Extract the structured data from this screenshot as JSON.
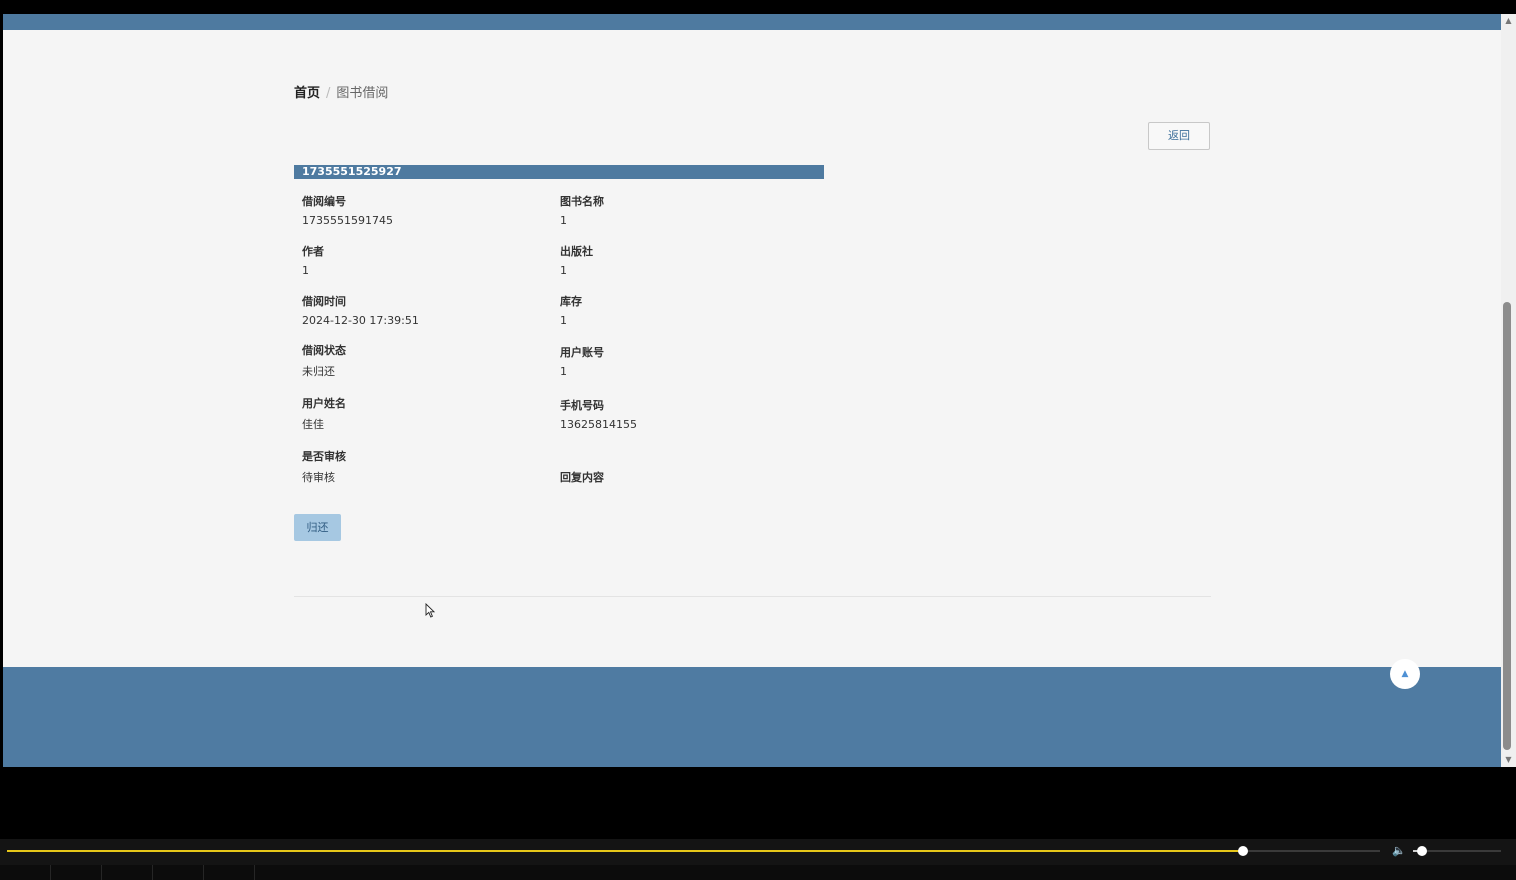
{
  "breadcrumb": {
    "home": "首页",
    "separator": "/",
    "current": "图书借阅"
  },
  "actions": {
    "back_label": "返回",
    "return_label": "归还"
  },
  "record": {
    "title": "1735551525927",
    "fields": [
      {
        "label": "借阅编号",
        "value": "1735551591745"
      },
      {
        "label": "图书名称",
        "value": "1"
      },
      {
        "label": "作者",
        "value": "1"
      },
      {
        "label": "出版社",
        "value": "1"
      },
      {
        "label": "借阅时间",
        "value": "2024-12-30 17:39:51"
      },
      {
        "label": "库存",
        "value": "1"
      },
      {
        "label": "借阅状态",
        "value": "未归还"
      },
      {
        "label": "用户账号",
        "value": "1"
      },
      {
        "label": "用户姓名",
        "value": "佳佳"
      },
      {
        "label": "手机号码",
        "value": "13625814155"
      },
      {
        "label": "是否审核",
        "value": "待审核"
      },
      {
        "label": "回复内容",
        "value": ""
      }
    ]
  },
  "icons": {
    "to_top": "chevron-up-icon",
    "volume": "volume-icon",
    "scroll_up": "scroll-up-arrow-icon",
    "scroll_down": "scroll-down-arrow-icon",
    "cursor": "mouse-pointer-icon"
  },
  "media": {
    "seek_progress": 0.9,
    "volume_level": 0.1
  },
  "colors": {
    "primary": "#4e7aa0",
    "page_bg": "#f5f5f5",
    "button_light": "#a6c8e2",
    "link": "#3b6e9a",
    "seek": "#e6c619"
  }
}
